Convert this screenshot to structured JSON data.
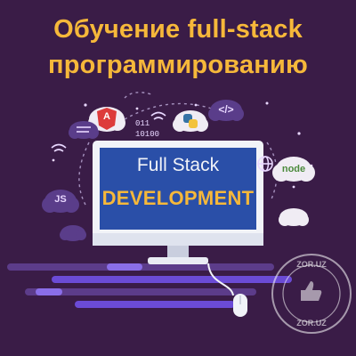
{
  "header": {
    "line1": "Обучение full-stack",
    "line2": "программированию"
  },
  "monitor": {
    "line1": "Full Stack",
    "line2": "DEVELOPMENT"
  },
  "binary": {
    "line1": "011",
    "line2": "10100"
  },
  "icons": {
    "angular": "angular-icon",
    "python": "python-icon",
    "code": "code-brackets-icon",
    "globe": "globe-icon",
    "node": "node-icon",
    "js": "js-icon",
    "wifi": "wifi-icon",
    "mouse": "mouse-icon",
    "thumb": "thumbs-up-icon"
  },
  "labels": {
    "code_brackets": "</>",
    "node": "node",
    "js": "JS",
    "angular": "A"
  },
  "watermark": {
    "top": "ZOR.UZ",
    "bottom": "ZOR.UZ"
  },
  "colors": {
    "background": "#3a1c47",
    "title": "#f6b83a",
    "screen": "#2a4fa8",
    "accent_purple": "#6b4bd6"
  }
}
